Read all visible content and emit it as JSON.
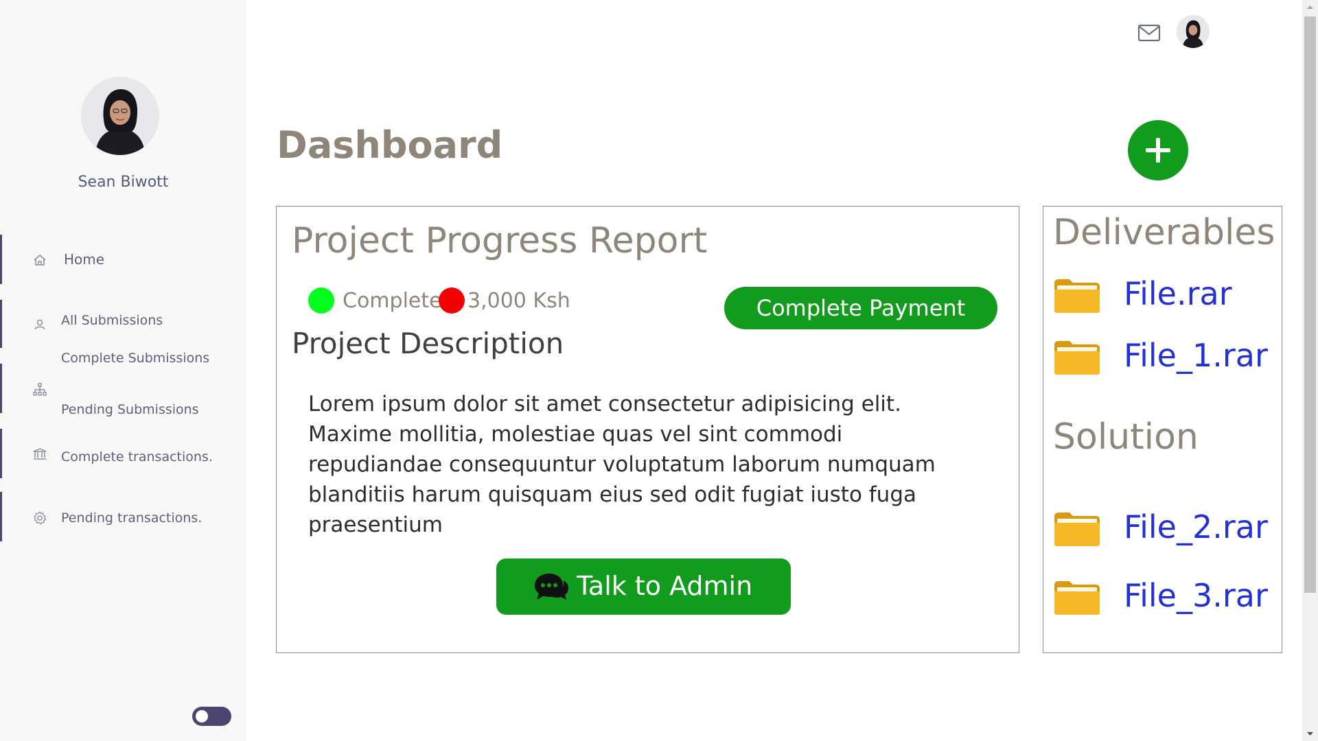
{
  "sidebar": {
    "user_name": "Sean Biwott",
    "nav": [
      {
        "label": "Home",
        "icon": "home-icon"
      },
      {
        "label": "All Submissions",
        "icon": "user-icon"
      },
      {
        "label": "Complete Submissions"
      },
      {
        "label": "Pending Submissions",
        "icon": "sitemap-icon"
      },
      {
        "label": "Complete transactions.",
        "icon": "bank-icon"
      },
      {
        "label": "Pending transactions.",
        "icon": "gear-icon"
      }
    ],
    "theme_toggle": "toggle"
  },
  "topbar": {
    "mail_icon": "mail-icon",
    "avatar": "user-avatar"
  },
  "main": {
    "title": "Dashboard",
    "report": {
      "title": "Project Progress Report",
      "status_label": "Complete",
      "amount": "3,000 Ksh",
      "pay_button": "Complete Payment",
      "description_title": "Project Description",
      "description": "Lorem ipsum dolor sit amet consectetur adipisicing elit. Maxime mollitia, molestiae quas vel sint commodi repudiandae consequuntur voluptatum laborum numquam blanditiis harum quisquam eius sed odit fugiat iusto fuga praesentium",
      "admin_button": "Talk to Admin"
    },
    "deliverables": {
      "title": "Deliverables",
      "files": [
        "File.rar",
        "File_1.rar"
      ]
    },
    "solution": {
      "title": "Solution",
      "files": [
        "File_2.rar",
        "File_3.rar"
      ]
    }
  },
  "colors": {
    "accent_green": "#119c1e",
    "status_complete": "#00ff1a",
    "status_pending": "#f40000",
    "link_blue": "#2230d6",
    "heading_gray": "#8f8579",
    "sidebar_accent": "#4a4670",
    "folder_yellow": "#f2b62a"
  }
}
